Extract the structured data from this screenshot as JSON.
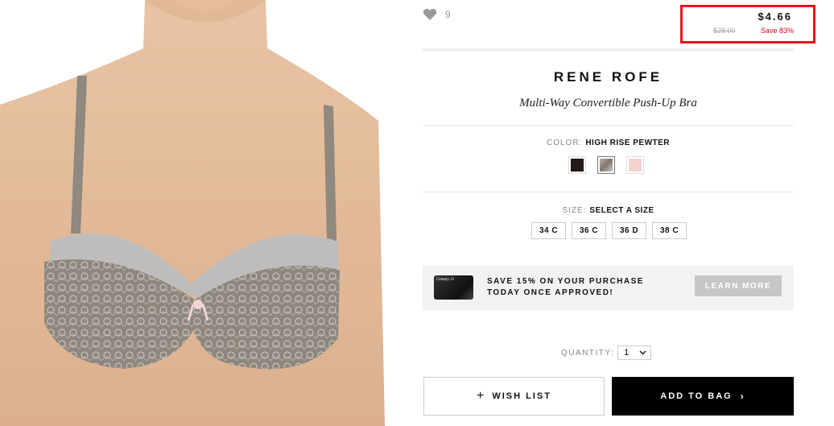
{
  "favorites": {
    "count": "9",
    "icon": "heart-icon"
  },
  "price": {
    "current": "$4.66",
    "original": "$28.00",
    "savings": "Save 83%"
  },
  "product": {
    "brand": "RENE ROFE",
    "name": "Multi-Way Convertible Push-Up Bra"
  },
  "color": {
    "label": "COLOR:",
    "selected": "HIGH RISE PEWTER",
    "swatches": [
      "#231b17",
      "#9e9890",
      "#f4d3cf"
    ]
  },
  "size": {
    "label": "SIZE:",
    "selected": "SELECT A SIZE",
    "options": [
      "34 C",
      "36 C",
      "36 D",
      "38 C"
    ]
  },
  "promo": {
    "line1": "SAVE 15% ON YOUR PURCHASE",
    "line2": "TODAY ONCE APPROVED!",
    "button": "LEARN MORE",
    "card_label": "Century 21"
  },
  "quantity": {
    "label": "QUANTITY:",
    "value": "1"
  },
  "actions": {
    "wishlist": "WISH LIST",
    "add_to_bag": "ADD TO BAG"
  },
  "colors": {
    "highlight": "#e8141b",
    "savings_red": "#d0021b",
    "button_black": "#000000"
  }
}
